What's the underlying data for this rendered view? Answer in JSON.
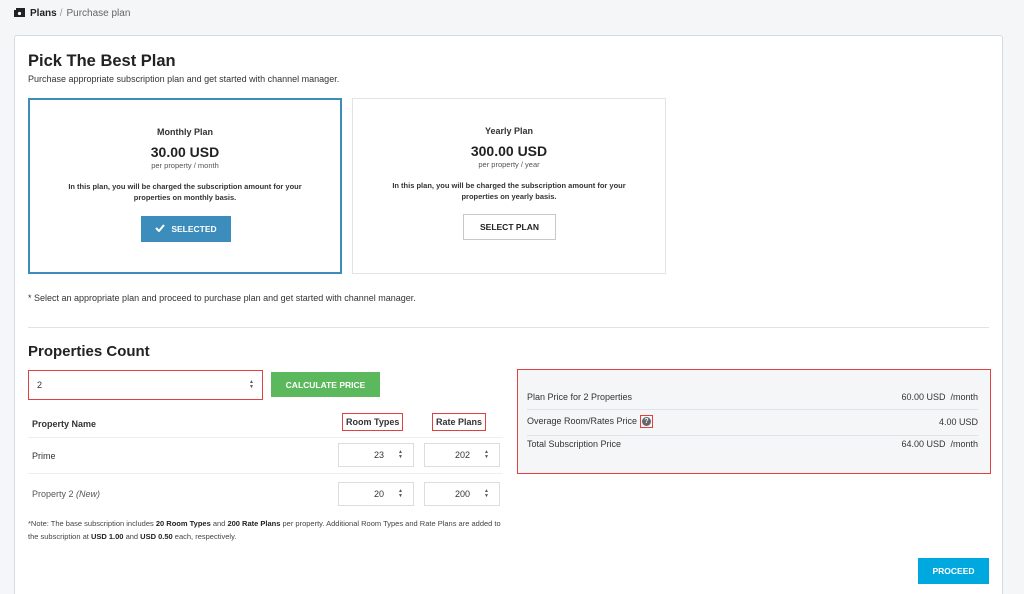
{
  "breadcrumb": {
    "home": "Plans",
    "separator": "/",
    "current": "Purchase plan"
  },
  "header": {
    "title": "Pick The Best Plan",
    "subtitle": "Purchase appropriate subscription plan and get started with channel manager."
  },
  "plans": [
    {
      "name": "Monthly Plan",
      "price": "30.00 USD",
      "unit": "per property / month",
      "desc_line1": "In this plan, you will be charged the subscription amount for your",
      "desc_line2": "properties on monthly basis.",
      "button": "SELECTED",
      "selected": true
    },
    {
      "name": "Yearly Plan",
      "price": "300.00 USD",
      "unit": "per property / year",
      "desc_line1": "In this plan, you will be charged the subscription amount for your",
      "desc_line2": "properties on yearly basis.",
      "button": "SELECT PLAN",
      "selected": false
    }
  ],
  "plan_note": "* Select an appropriate plan and proceed to purchase plan and get started with channel manager.",
  "properties": {
    "title": "Properties Count",
    "count_value": "2",
    "calculate_label": "CALCULATE PRICE",
    "columns": {
      "name": "Property Name",
      "room_types": "Room Types",
      "rate_plans": "Rate Plans"
    },
    "rows": [
      {
        "name": "Prime",
        "suffix": "",
        "room_types": "23",
        "rate_plans": "202"
      },
      {
        "name": "Property 2",
        "suffix": "(New)",
        "room_types": "20",
        "rate_plans": "200"
      }
    ]
  },
  "footnote": {
    "p1": "*Note: The base subscription includes ",
    "b1": "20 Room Types",
    "p2": " and ",
    "b2": "200 Rate Plans",
    "p3": " per property. Additional Room Types and Rate Plans are added to the subscription at ",
    "b3": "USD 1.00",
    "p4": " and ",
    "b4": "USD 0.50",
    "p5": " each, respectively."
  },
  "summary": {
    "plan_price_label": "Plan Price for 2 Properties",
    "plan_price_value": "60.00 USD  /month",
    "overage_label": "Overage Room/Rates Price",
    "overage_value": "4.00 USD",
    "total_label": "Total Subscription Price",
    "total_value": "64.00 USD  /month"
  },
  "proceed_label": "PROCEED",
  "colors": {
    "primary": "#3c8dbc",
    "success": "#5cb85c",
    "proceed": "#00a8e0",
    "highlight": "#e04040"
  }
}
